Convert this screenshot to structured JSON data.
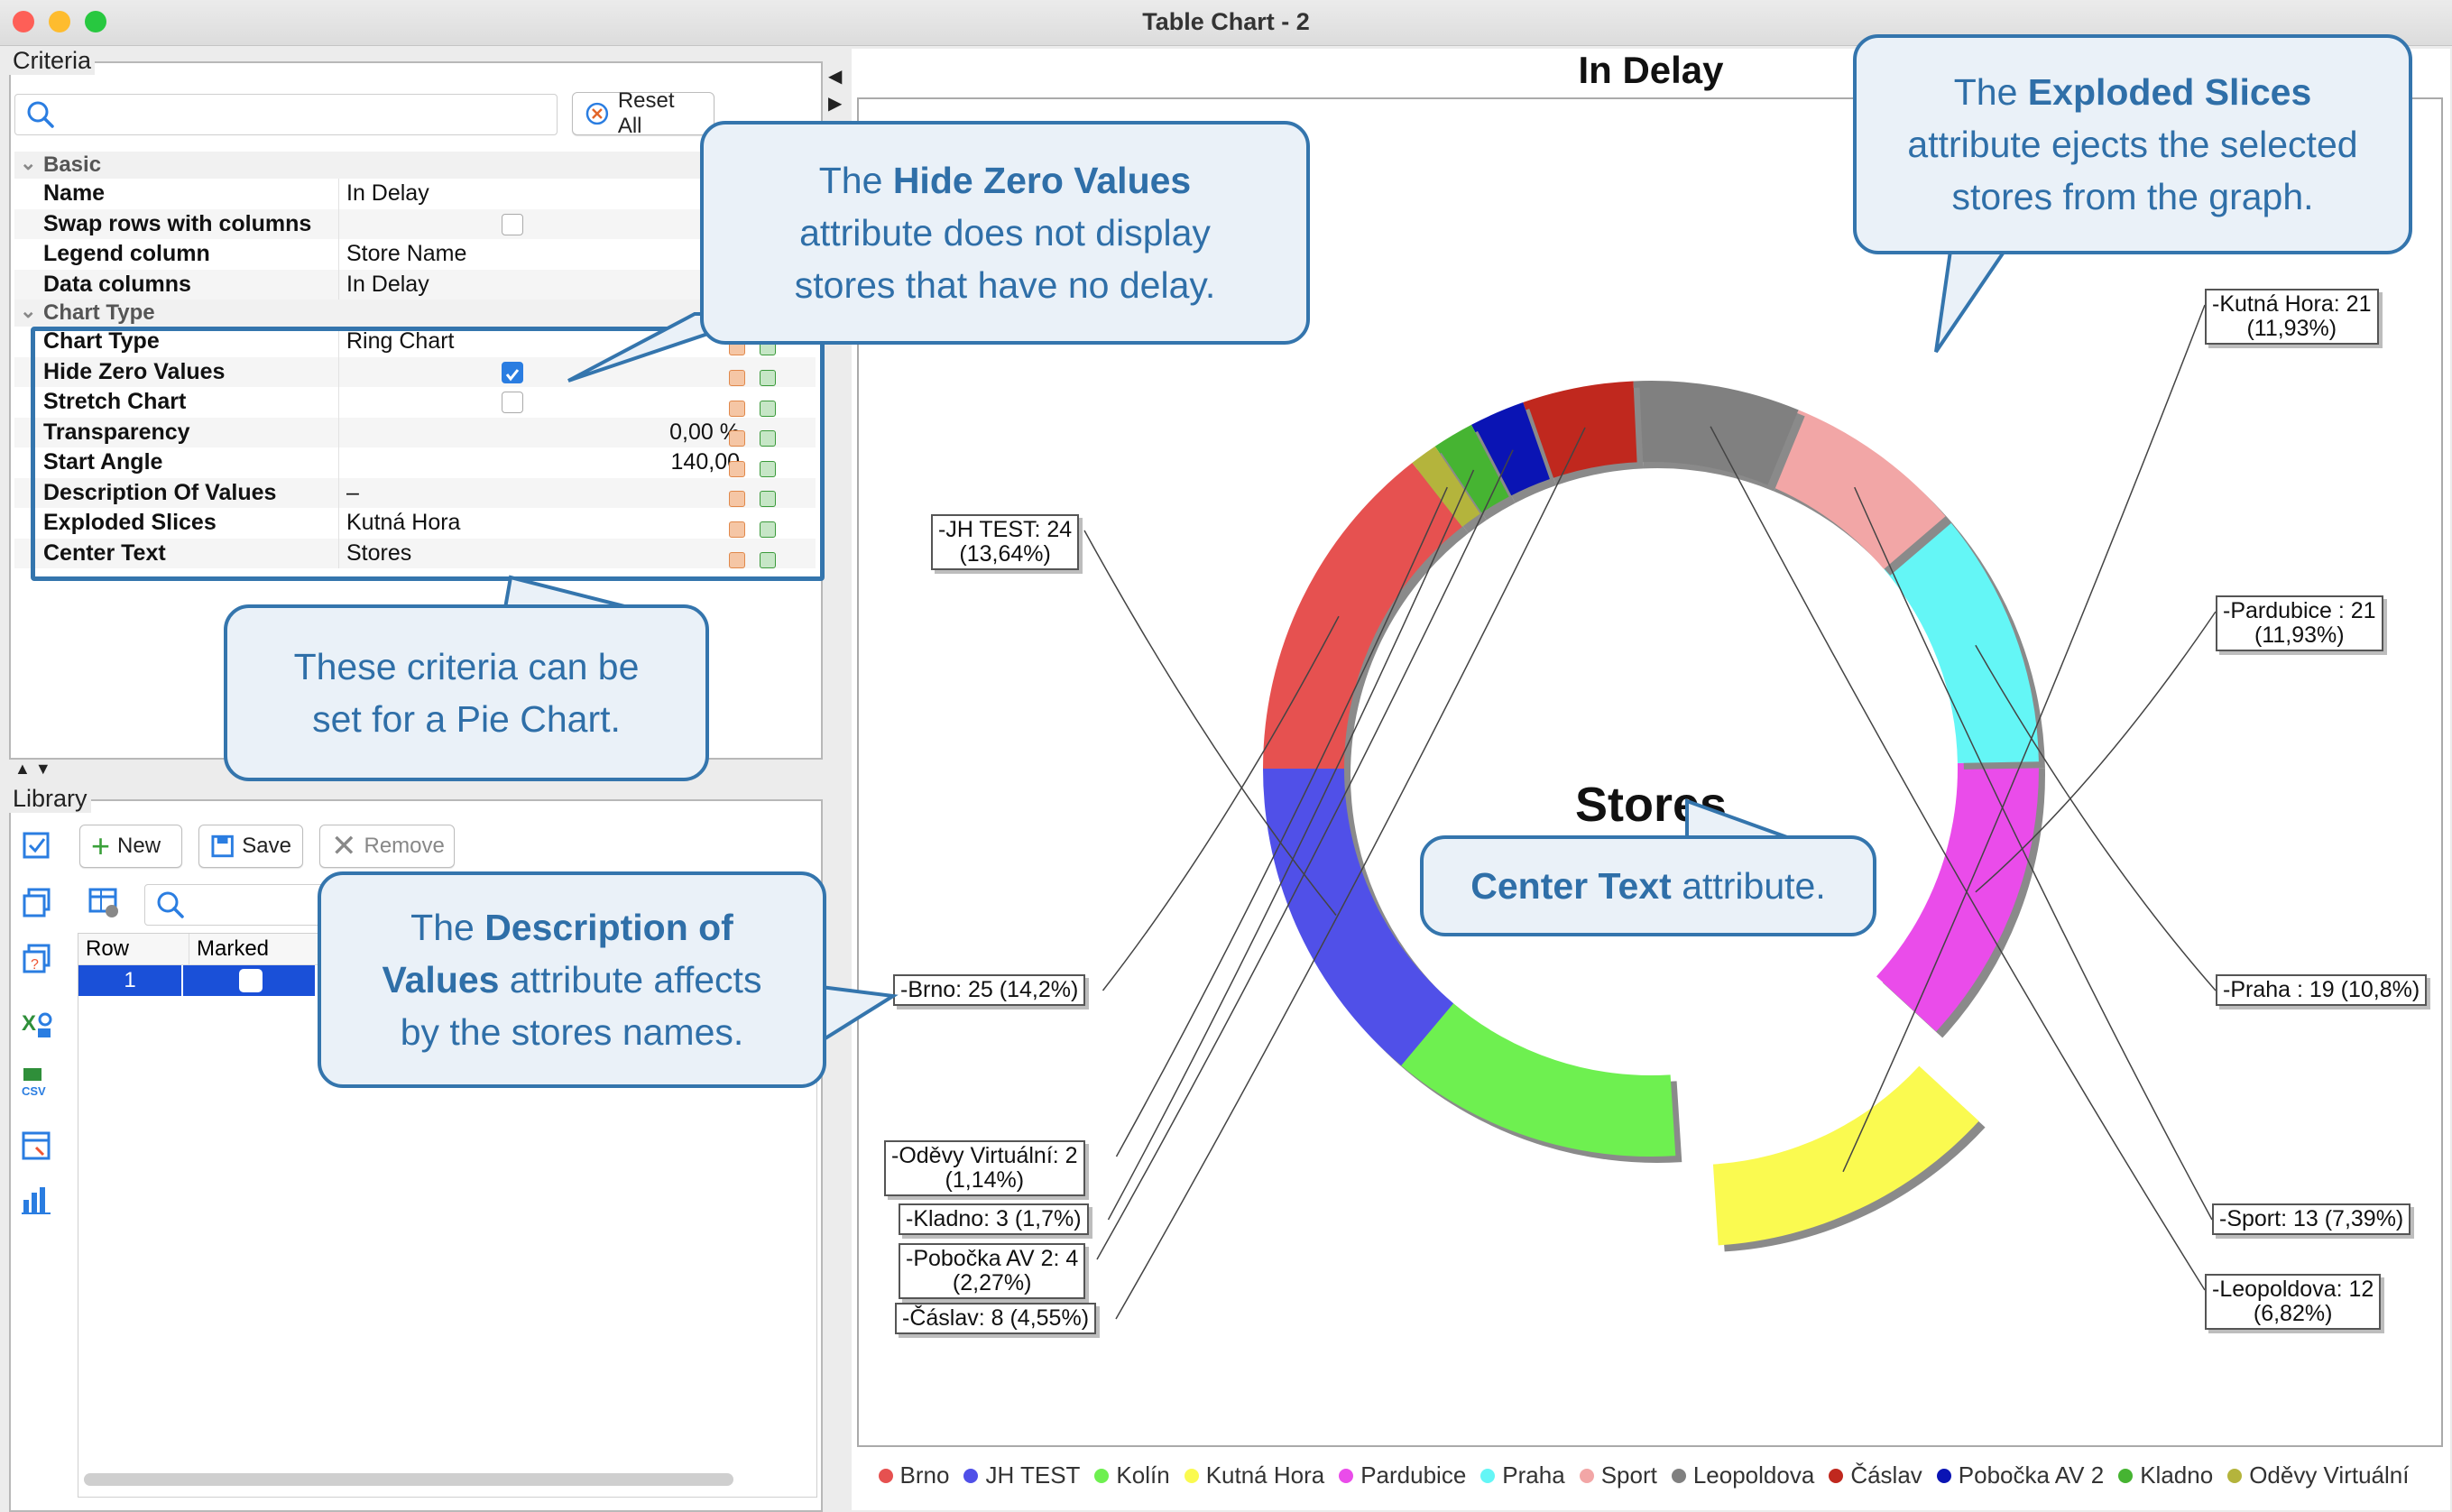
{
  "window": {
    "title": "Table Chart - 2"
  },
  "criteria": {
    "section_label": "Criteria",
    "reset_label": "Reset All",
    "search_placeholder": "",
    "groups": [
      {
        "title": "Basic",
        "rows": [
          {
            "name": "Name",
            "value": "In Delay"
          },
          {
            "name": "Swap rows with columns",
            "value": ""
          },
          {
            "name": "Legend column",
            "value": "Store Name"
          },
          {
            "name": "Data columns",
            "value": "In Delay"
          }
        ]
      },
      {
        "title": "Chart Type",
        "rows": [
          {
            "name": "Chart Type",
            "value": "Ring Chart"
          },
          {
            "name": "Hide Zero Values",
            "value": ""
          },
          {
            "name": "Stretch Chart",
            "value": ""
          },
          {
            "name": "Transparency",
            "value": "0,00 %"
          },
          {
            "name": "Start Angle",
            "value": "140,00"
          },
          {
            "name": "Description Of Values",
            "value": "–"
          },
          {
            "name": "Exploded Slices",
            "value": "Kutná Hora"
          },
          {
            "name": "Center Text",
            "value": "Stores"
          }
        ]
      }
    ],
    "checkbox_states": {
      "swap_rows": false,
      "hide_zero": true,
      "stretch_chart": false
    }
  },
  "library": {
    "section_label": "Library",
    "new_label": "New",
    "save_label": "Save",
    "remove_label": "Remove",
    "columns": [
      "Row",
      "Marked"
    ],
    "rows": [
      {
        "row": "1",
        "marked": false
      }
    ]
  },
  "callouts": {
    "hide_zero": {
      "pre": "The ",
      "bold": "Hide Zero Values",
      "post1": "attribute does not display",
      "post2": "stores that have no delay."
    },
    "pie_chart": {
      "line1": "These criteria can be",
      "line2": "set for a Pie Chart."
    },
    "description": {
      "pre": "The ",
      "bold1": "Description of",
      "bold2": "Values",
      "post1": " attribute affects",
      "post2": "by the stores names."
    },
    "exploded": {
      "pre": "The ",
      "bold": "Exploded Slices",
      "post1": "attribute ejects the selected",
      "post2": "stores from the graph."
    },
    "center": {
      "bold": "Center Text",
      "post": " attribute."
    }
  },
  "colors": {
    "accent": "#3475ad",
    "callout_bg": "#eaf1f8",
    "selection": "#1a50d8"
  },
  "chart_data": {
    "type": "pie",
    "variant": "ring",
    "title": "In Delay",
    "center_text": "Stores",
    "start_angle": 140,
    "exploded": [
      "Kutná Hora"
    ],
    "slices": [
      {
        "name": "Brno",
        "value": 25,
        "label": "-Brno: 25 (14,2%)",
        "color": "#e65150"
      },
      {
        "name": "JH TEST",
        "value": 24,
        "label": "-JH TEST: 24\n(13,64%)",
        "color": "#5050e8"
      },
      {
        "name": "Kolín",
        "value": 21,
        "label": "",
        "color": "#6ef050"
      },
      {
        "name": "Kutná Hora",
        "value": 21,
        "label": "-Kutná Hora: 21\n(11,93%)",
        "color": "#fafa50"
      },
      {
        "name": "Pardubice",
        "value": 21,
        "label": "-Pardubice : 21\n(11,93%)",
        "color": "#ea4cea"
      },
      {
        "name": "Praha",
        "value": 19,
        "label": "-Praha : 19 (10,8%)",
        "color": "#64f6f6"
      },
      {
        "name": "Sport",
        "value": 13,
        "label": "-Sport: 13 (7,39%)",
        "color": "#f2a6a6"
      },
      {
        "name": "Leopoldova",
        "value": 12,
        "label": "-Leopoldova: 12\n(6,82%)",
        "color": "#808080"
      },
      {
        "name": "Čáslav",
        "value": 8,
        "label": "-Čáslav: 8 (4,55%)",
        "color": "#c0281e"
      },
      {
        "name": "Pobočka AV 2",
        "value": 4,
        "label": "-Pobočka AV 2: 4\n(2,27%)",
        "color": "#0a14b4"
      },
      {
        "name": "Kladno",
        "value": 3,
        "label": "-Kladno: 3 (1,7%)",
        "color": "#46b432"
      },
      {
        "name": "Oděvy Virtuální",
        "value": 2,
        "label": "-Oděvy Virtuální: 2\n(1,14%)",
        "color": "#b4b43c"
      }
    ],
    "legend": {
      "position": "bottom"
    }
  }
}
